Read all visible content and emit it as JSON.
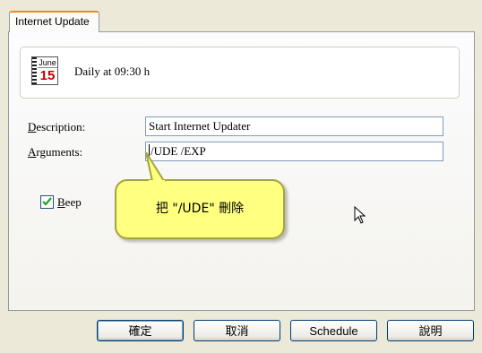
{
  "tab": {
    "label": "Internet Update"
  },
  "schedule": {
    "icon": "calendar-icon",
    "calendar_month": "June",
    "calendar_day": "15",
    "text": "Daily at 09:30 h"
  },
  "form": {
    "description": {
      "label_first": "D",
      "label_rest": "escription:",
      "value": "Start Internet Updater"
    },
    "arguments": {
      "label_first": "A",
      "label_rest": "rguments:",
      "value": "/UDE /EXP"
    },
    "beep": {
      "label_first": "B",
      "label_rest": "eep",
      "checked": true
    }
  },
  "annotation": {
    "text": "把 \"/UDE\" 刪除",
    "background": "#ffff80"
  },
  "buttons": {
    "ok": "確定",
    "cancel": "取消",
    "schedule": "Schedule",
    "help": "說明"
  }
}
